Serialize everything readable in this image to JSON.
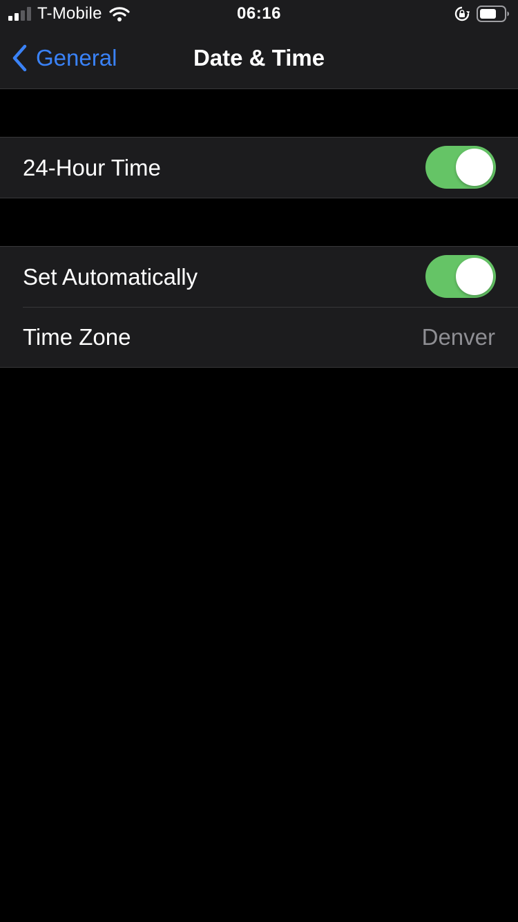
{
  "status_bar": {
    "carrier": "T-Mobile",
    "time": "06:16",
    "signal_icon": "cellular-signal-icon",
    "wifi_icon": "wifi-icon",
    "rotation_lock_icon": "rotation-lock-icon",
    "battery_icon": "battery-icon"
  },
  "nav": {
    "back_label": "General",
    "title": "Date & Time",
    "back_icon": "chevron-left-icon"
  },
  "settings": {
    "hour_24": {
      "label": "24-Hour Time",
      "on": true
    },
    "set_automatically": {
      "label": "Set Automatically",
      "on": true
    },
    "time_zone": {
      "label": "Time Zone",
      "value": "Denver"
    }
  },
  "colors": {
    "background": "#000000",
    "cell_background": "#1c1c1e",
    "accent_blue": "#3a82f7",
    "toggle_on": "#65c466",
    "secondary_text": "#8e8e93"
  }
}
